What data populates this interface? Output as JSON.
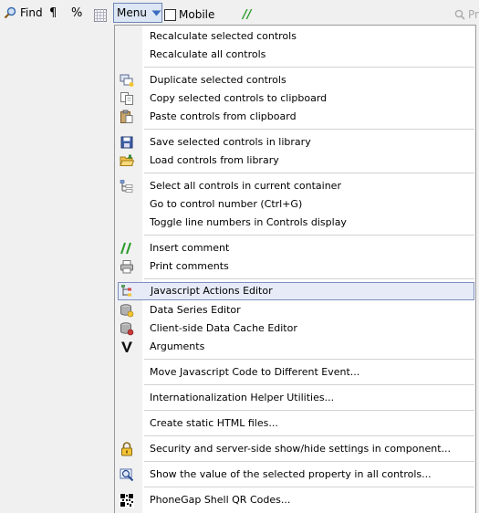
{
  "toolbar": {
    "find_label": "Find",
    "pilcrow": "¶",
    "percent": "%",
    "menu_label": "Menu",
    "mobile_label": "Mobile",
    "comment_glyph": "//",
    "search_partial": "Pr"
  },
  "menu": {
    "items": [
      {
        "label": "Recalculate selected controls",
        "icon": "none"
      },
      {
        "label": "Recalculate all controls",
        "icon": "none"
      },
      {
        "label": "Duplicate selected controls",
        "icon": "duplicate-icon"
      },
      {
        "label": "Copy selected controls to clipboard",
        "icon": "copy-icon"
      },
      {
        "label": "Paste controls from clipboard",
        "icon": "paste-icon"
      },
      {
        "label": "Save selected controls in library",
        "icon": "save-icon"
      },
      {
        "label": "Load controls from library",
        "icon": "folder-open-icon"
      },
      {
        "label": "Select all controls in current container",
        "icon": "tree-select-icon"
      },
      {
        "label": "Go to control number (Ctrl+G)",
        "icon": "none"
      },
      {
        "label": "Toggle line numbers in Controls display",
        "icon": "none"
      },
      {
        "label": "Insert comment",
        "icon": "comment-icon"
      },
      {
        "label": "Print comments",
        "icon": "printer-icon"
      },
      {
        "label": "Javascript Actions Editor",
        "icon": "js-actions-icon",
        "highlighted": true
      },
      {
        "label": "Data Series Editor",
        "icon": "database-icon"
      },
      {
        "label": "Client-side Data Cache Editor",
        "icon": "database-cache-icon"
      },
      {
        "label": "Arguments",
        "icon": "arguments-icon"
      },
      {
        "label": "Move Javascript Code to Different Event...",
        "icon": "none"
      },
      {
        "label": "Internationalization Helper Utilities...",
        "icon": "none"
      },
      {
        "label": "Create static HTML files...",
        "icon": "none"
      },
      {
        "label": "Security and server-side show/hide settings in component...",
        "icon": "lock-icon"
      },
      {
        "label": "Show the value of the selected property in all controls...",
        "icon": "magnify-icon"
      },
      {
        "label": "PhoneGap Shell QR Codes...",
        "icon": "qr-code-icon"
      }
    ]
  }
}
